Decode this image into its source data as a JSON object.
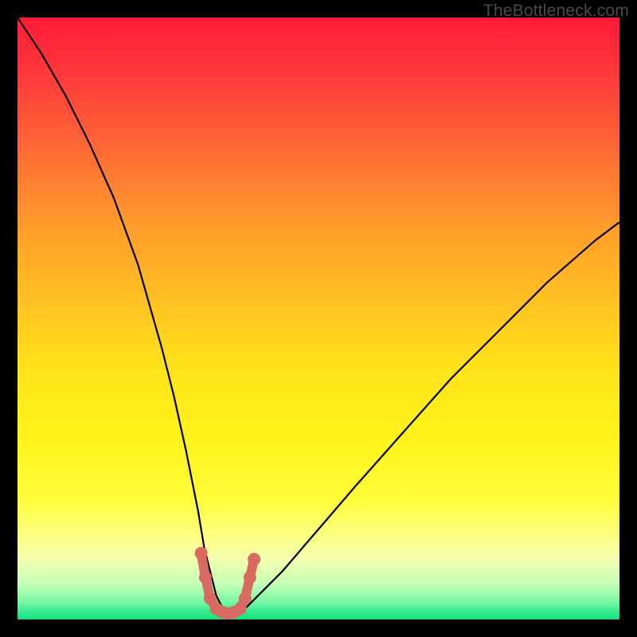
{
  "watermark": {
    "text": "TheBottleneck.com"
  },
  "colors": {
    "background": "#000000",
    "curve": "#000000",
    "marker": "#d86a62",
    "gradient_top": "#ff1a3a",
    "gradient_bottom": "#16e07c"
  },
  "chart_data": {
    "type": "line",
    "title": "",
    "xlabel": "",
    "ylabel": "",
    "xlim": [
      0,
      100
    ],
    "ylim": [
      0,
      100
    ],
    "grid": false,
    "legend": false,
    "note": "Axes are unlabeled in the source image; values are normalized 0–100 estimates read from geometry. y≈100 at top (high bottleneck / red), y≈0 at bottom (no bottleneck / green).",
    "series": [
      {
        "name": "bottleneck-curve",
        "x": [
          0,
          4,
          8,
          12,
          16,
          20,
          24,
          26,
          28,
          30,
          31,
          32,
          33,
          34,
          35,
          36,
          37,
          38,
          40,
          44,
          50,
          56,
          64,
          72,
          80,
          88,
          96,
          100
        ],
        "values": [
          100,
          94,
          87,
          79,
          70,
          59,
          45,
          37,
          28,
          18,
          12,
          8,
          4,
          2,
          1,
          1,
          1,
          2,
          4,
          8,
          15,
          22,
          31,
          40,
          48,
          56,
          63,
          66
        ]
      },
      {
        "name": "optimal-range-markers",
        "x": [
          30.5,
          31.2,
          32.0,
          33.0,
          34.0,
          35.0,
          36.0,
          37.0,
          37.8,
          38.6,
          39.3
        ],
        "values": [
          11.0,
          7.0,
          3.5,
          1.8,
          1.2,
          1.0,
          1.2,
          1.8,
          3.5,
          7.0,
          10.0
        ]
      }
    ]
  }
}
